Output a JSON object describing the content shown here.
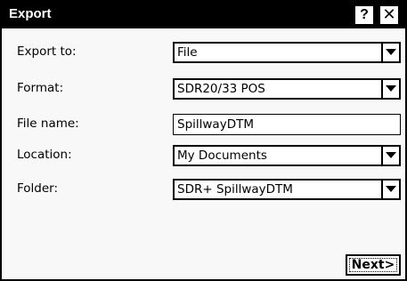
{
  "window": {
    "title": "Export",
    "help_label": "?",
    "close_label": "✕"
  },
  "form": {
    "export_to": {
      "label": "Export to:",
      "value": "File"
    },
    "format": {
      "label": "Format:",
      "value": "SDR20/33 POS"
    },
    "file_name": {
      "label": "File name:",
      "value": "SpillwayDTM"
    },
    "location": {
      "label": "Location:",
      "value": "My Documents"
    },
    "folder": {
      "label": "Folder:",
      "value": "SDR+ SpillwayDTM"
    }
  },
  "buttons": {
    "next_label": "Next>"
  }
}
